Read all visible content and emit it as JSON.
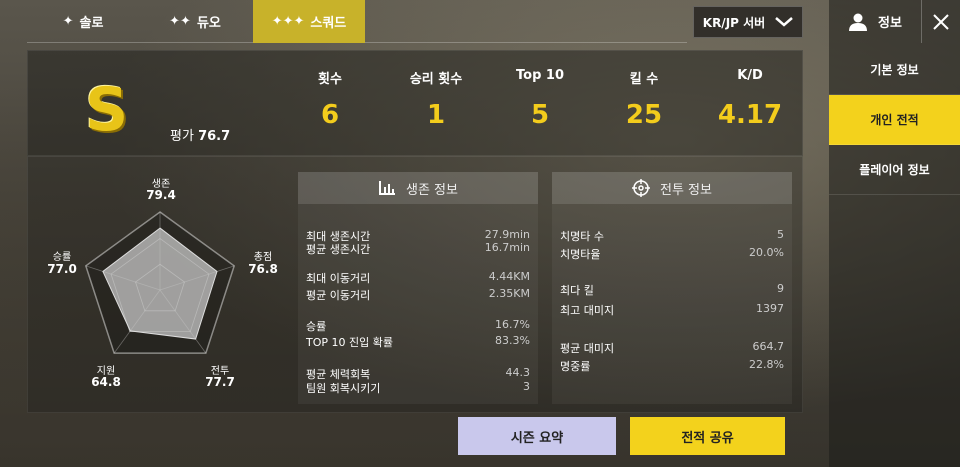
{
  "tabs": [
    {
      "label": "솔로",
      "icon": "person-icon",
      "active": false
    },
    {
      "label": "듀오",
      "icon": "two-person-icon",
      "active": false
    },
    {
      "label": "스쿼드",
      "icon": "squad-icon",
      "active": true
    }
  ],
  "server": {
    "label": "KR/JP 서버"
  },
  "sidebar": {
    "header": "정보",
    "items": [
      {
        "label": "기본 정보",
        "active": false
      },
      {
        "label": "개인 전적",
        "active": true
      },
      {
        "label": "플레이어 정보",
        "active": false
      }
    ]
  },
  "rank": {
    "letter": "S",
    "rating_label": "평가",
    "rating_value": "76.7"
  },
  "stats": [
    {
      "label": "횟수",
      "value": "6"
    },
    {
      "label": "승리 횟수",
      "value": "1"
    },
    {
      "label": "Top 10",
      "value": "5"
    },
    {
      "label": "킬 수",
      "value": "25"
    },
    {
      "label": "K/D",
      "value": "4.17"
    }
  ],
  "radar": {
    "axes": [
      {
        "label": "생존",
        "value": "79.4",
        "score": 79.4
      },
      {
        "label": "총점",
        "value": "76.8",
        "score": 76.8
      },
      {
        "label": "전투",
        "value": "77.7",
        "score": 77.7
      },
      {
        "label": "지원",
        "value": "64.8",
        "score": 64.8
      },
      {
        "label": "승률",
        "value": "77.0",
        "score": 77.0
      }
    ]
  },
  "survival": {
    "title": "생존 정보",
    "rows": [
      {
        "label": "최대 생존시간",
        "value": "27.9min"
      },
      {
        "label": "평균 생존시간",
        "value": "16.7min"
      },
      {
        "label": "최대 이동거리",
        "value": "4.44KM"
      },
      {
        "label": "평균 이동거리",
        "value": "2.35KM"
      },
      {
        "label": "승률",
        "value": "16.7%"
      },
      {
        "label": "TOP 10 진입 확률",
        "value": "83.3%"
      },
      {
        "label": "평균 체력회복",
        "value": "44.3"
      },
      {
        "label": "팀원 회복시키기",
        "value": "3"
      }
    ]
  },
  "combat": {
    "title": "전투 정보",
    "rows": [
      {
        "label": "치명타 수",
        "value": "5"
      },
      {
        "label": "치명타율",
        "value": "20.0%"
      },
      {
        "label": "최다 킬",
        "value": "9"
      },
      {
        "label": "최고 대미지",
        "value": "1397"
      },
      {
        "label": "평균 대미지",
        "value": "664.7"
      },
      {
        "label": "명중률",
        "value": "22.8%"
      }
    ]
  },
  "buttons": {
    "season_summary": "시즌 요약",
    "share": "전적 공유"
  },
  "colors": {
    "accent": "#f3d21c",
    "tab_active": "#c8b22a",
    "value": "#f3cc1c",
    "summary_btn": "#c9c8ec"
  }
}
